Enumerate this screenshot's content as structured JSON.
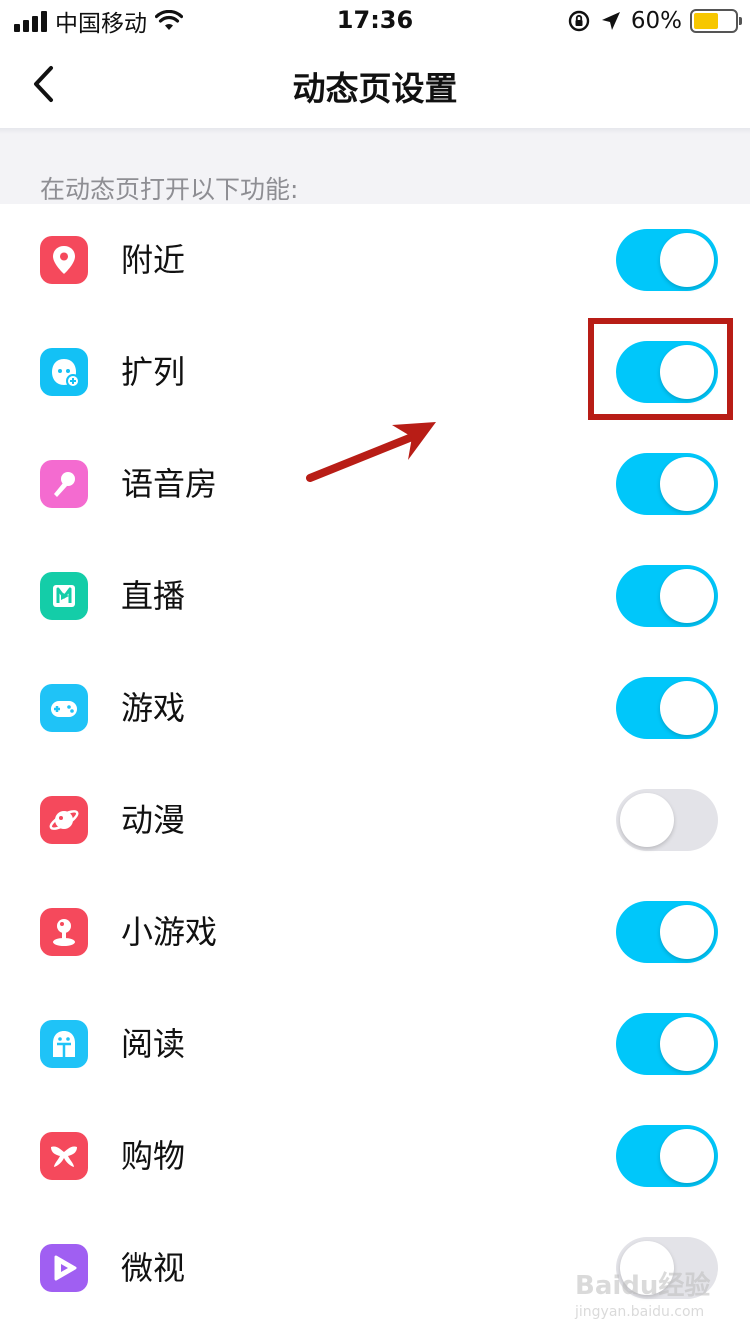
{
  "status_bar": {
    "carrier": "中国移动",
    "time": "17:36",
    "battery_percent": "60%",
    "battery_level": 0.6
  },
  "nav": {
    "back_icon": "chevron-left-icon",
    "title": "动态页设置"
  },
  "section": {
    "label": "在动态页打开以下功能:"
  },
  "items": [
    {
      "label": "附近",
      "icon": "location-pin-icon",
      "color": "#f5495c",
      "enabled": true
    },
    {
      "label": "扩列",
      "icon": "face-add-icon",
      "color": "#13c1f5",
      "enabled": true
    },
    {
      "label": "语音房",
      "icon": "microphone-icon",
      "color": "#f46bd0",
      "enabled": true
    },
    {
      "label": "直播",
      "icon": "live-n-icon",
      "color": "#14cda8",
      "enabled": true
    },
    {
      "label": "游戏",
      "icon": "gamepad-icon",
      "color": "#1fc3f7",
      "enabled": true
    },
    {
      "label": "动漫",
      "icon": "planet-icon",
      "color": "#f5495c",
      "enabled": false
    },
    {
      "label": "小游戏",
      "icon": "joystick-icon",
      "color": "#f5495c",
      "enabled": true
    },
    {
      "label": "阅读",
      "icon": "reader-icon",
      "color": "#1fc3f7",
      "enabled": true
    },
    {
      "label": "购物",
      "icon": "shopping-bow-icon",
      "color": "#f5495c",
      "enabled": true
    },
    {
      "label": "微视",
      "icon": "play-icon",
      "color": "#a05ff2",
      "enabled": false
    }
  ],
  "annotation": {
    "highlight_color": "#b81d16",
    "highlighted_item": "扩列"
  },
  "watermark": {
    "logo": "Baidu经验",
    "url": "jingyan.baidu.com"
  }
}
